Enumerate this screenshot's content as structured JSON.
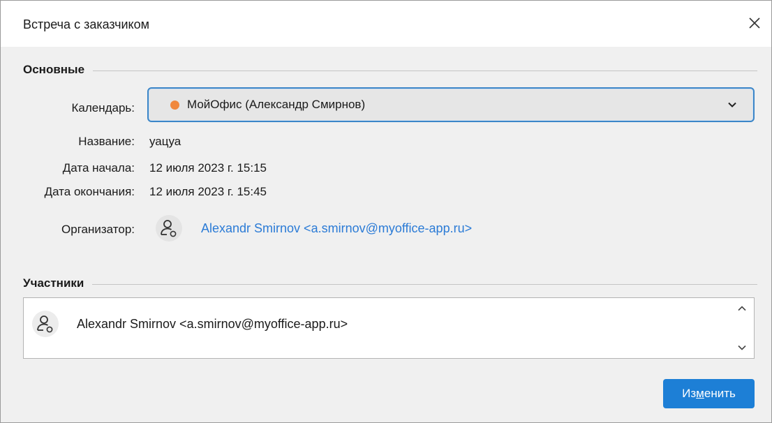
{
  "window": {
    "title": "Встреча с заказчиком"
  },
  "sections": {
    "main": "Основные",
    "participants": "Участники"
  },
  "fields": {
    "calendar_label": "Календарь:",
    "calendar_value": "МойОфис (Александр Смирнов)",
    "calendar_color": "#f0883e",
    "name_label": "Название:",
    "name_value": "уацуа",
    "start_label": "Дата начала:",
    "start_value": "12 июля 2023 г. 15:15",
    "end_label": "Дата окончания:",
    "end_value": "12 июля 2023 г. 15:45",
    "organizer_label": "Организатор:",
    "organizer_value": "Alexandr Smirnov <a.smirnov@myoffice-app.ru>"
  },
  "participants": [
    {
      "name": "Alexandr Smirnov <a.smirnov@myoffice-app.ru>",
      "icon": "user-settings-icon"
    }
  ],
  "buttons": {
    "edit_pre": "Из",
    "edit_ul": "м",
    "edit_post": "енить"
  },
  "colors": {
    "accent": "#1d7fd6",
    "link": "#2b7bd6",
    "focus_border": "#3c86c8"
  }
}
